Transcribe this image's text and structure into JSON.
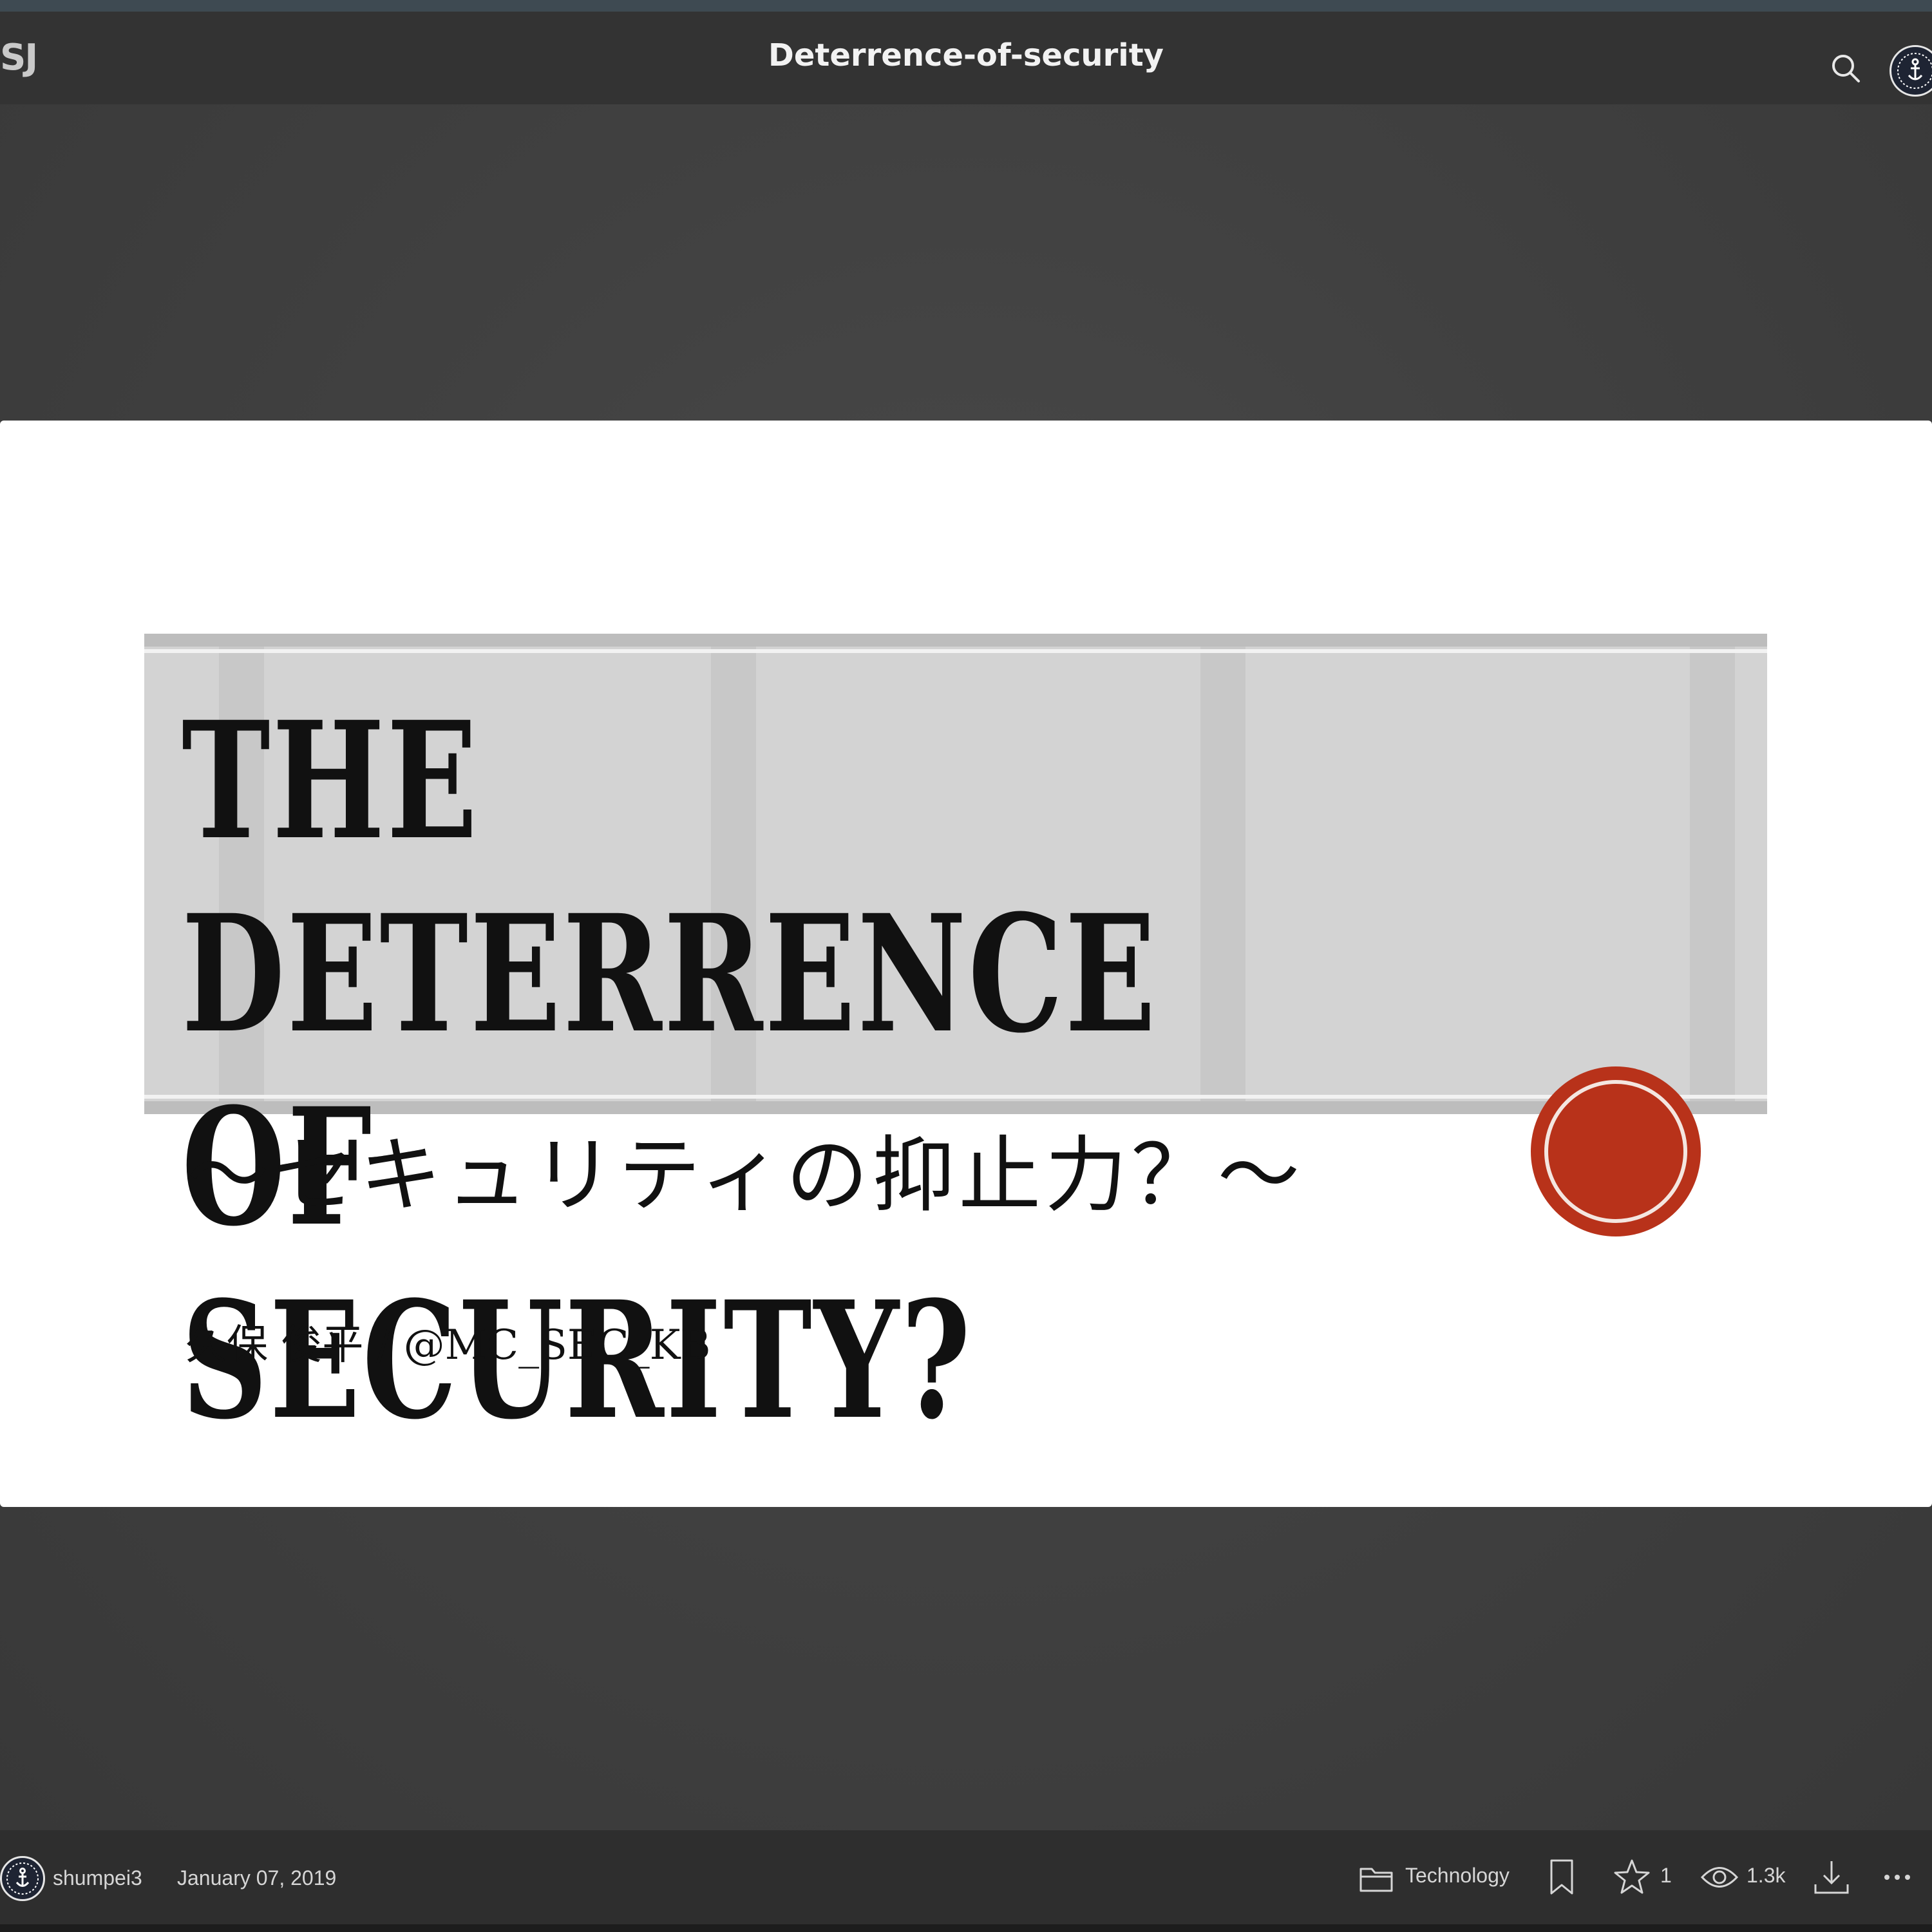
{
  "header": {
    "logo_text": "SJ",
    "title": "Deterrence-of-security"
  },
  "slide": {
    "title_line1": "THE DETERRENCE OF",
    "title_line2": "SECURITY?",
    "subtitle": "～セキュリティの抑止力？～",
    "author": "久保 俊平 / @MC_SEC_KB"
  },
  "footer": {
    "username": "shumpei3",
    "date": "January 07, 2019",
    "category": "Technology",
    "stars": "1",
    "views": "1.3k"
  },
  "icons": {
    "search": "search-icon",
    "avatar": "anchor-avatar",
    "folder": "folder-icon",
    "bookmark": "bookmark-icon",
    "star": "star-icon",
    "eye": "eye-icon",
    "download": "download-icon",
    "more": "more-icon"
  },
  "colors": {
    "header_bg": "#333333",
    "stage_bg": "#444444",
    "seal_red": "#b8321a",
    "banner_gray": "#d3d3d3"
  }
}
